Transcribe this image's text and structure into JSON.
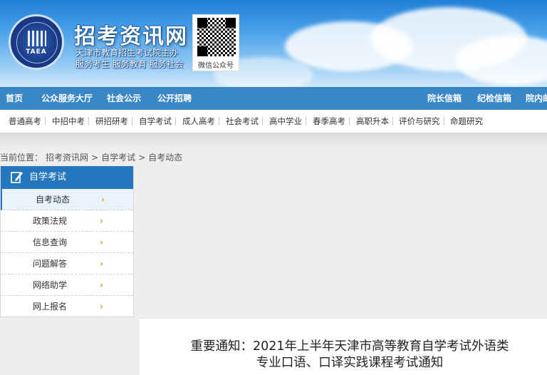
{
  "header": {
    "logo_abbr": "TAEA",
    "site_title": "招考资讯网",
    "subtitle_line1": "天津市教育招生考试院主办",
    "subtitle_line2": "服务考生 服务教育 服务社会",
    "qr_label": "微信公众号"
  },
  "nav_primary": {
    "items": [
      "首页",
      "公众服务大厅",
      "社会公示",
      "公开招聘"
    ],
    "right_items": [
      "院长信箱",
      "纪检信箱",
      "院内邮"
    ]
  },
  "nav_secondary": {
    "items": [
      "普通高考",
      "中招中考",
      "研招研考",
      "自学考试",
      "成人高考",
      "社会考试",
      "高中学业",
      "春季高考",
      "高职升本",
      "评价与研究",
      "命题研究"
    ]
  },
  "breadcrumb": {
    "items": [
      "当前位置：",
      "招考资讯网",
      ">",
      "自学考试",
      ">",
      "自考动态"
    ]
  },
  "sidebar": {
    "title": "自学考试",
    "items": [
      {
        "label": "自考动态",
        "active": true
      },
      {
        "label": "政策法规",
        "active": false
      },
      {
        "label": "信息查询",
        "active": false
      },
      {
        "label": "问题解答",
        "active": false
      },
      {
        "label": "网络助学",
        "active": false
      },
      {
        "label": "网上报名",
        "active": false
      }
    ],
    "arrow": "›"
  },
  "article": {
    "title_line1": "重要通知：2021年上半年天津市高等教育自学考试外语类",
    "title_line2": "专业口语、口译实践课程考试通知"
  },
  "colors": {
    "nav_primary_bg": "#3a87c8",
    "sidebar_head_bg": "#2476be",
    "arrow": "#e69a1e"
  }
}
